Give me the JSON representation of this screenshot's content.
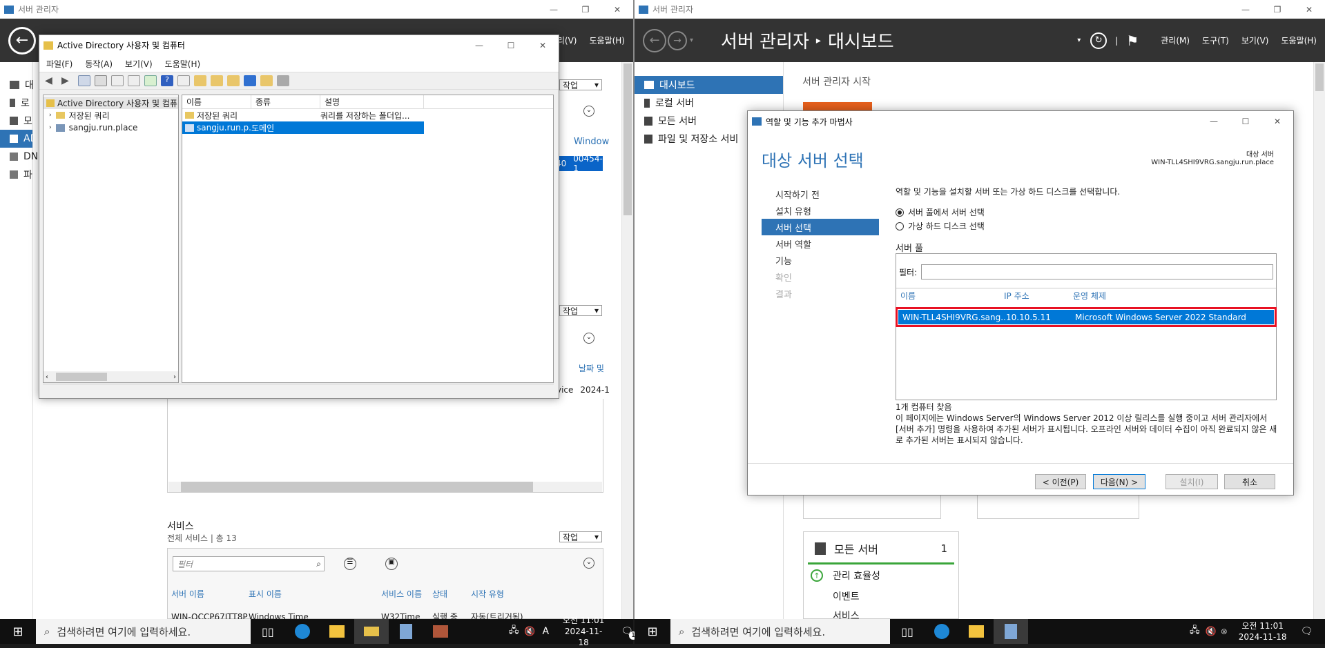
{
  "left_sm": {
    "title": "서버 관리자",
    "menus": [
      "리(V)",
      "도움말(H)"
    ],
    "nav": [
      "대",
      "로",
      "모",
      "AD",
      "DN",
      "파"
    ],
    "task_labels": [
      "작업",
      "작업",
      "작업"
    ],
    "fragments": {
      "windows": "Window",
      "row_a": "40",
      "row_b": "00454-1",
      "date_hdr": "날짜 및",
      "svc": "vice",
      "date_val": "2024-1"
    },
    "services": {
      "title": "서비스",
      "subtitle": "전체 서비스 | 총 13",
      "filter_placeholder": "필터",
      "columns": [
        "서버 이름",
        "표시 이름",
        "서비스 이름",
        "상태",
        "시작 유형"
      ],
      "row": [
        "WIN-OCCP67ITT8P",
        "Windows Time",
        "W32Time",
        "실행 중",
        "자동(트리거됨)"
      ]
    }
  },
  "ad": {
    "title": "Active Directory 사용자 및 컴퓨터",
    "menus": [
      "파일(F)",
      "동작(A)",
      "보기(V)",
      "도움말(H)"
    ],
    "tree_root": "Active Directory 사용자 및 컴퓨",
    "tree": [
      "저장된 쿼리",
      "sangju.run.place"
    ],
    "columns": [
      "이름",
      "종류",
      "설명"
    ],
    "rows": [
      {
        "name": "저장된 쿼리",
        "type": "",
        "desc": "쿼리를 저장하는 폴더입..."
      },
      {
        "name": "sangju.run.p...",
        "type": "도메인",
        "desc": ""
      }
    ]
  },
  "right_sm": {
    "title": "서버 관리자",
    "breadcrumb_a": "서버 관리자",
    "breadcrumb_b": "대시보드",
    "menus": [
      "관리(M)",
      "도구(T)",
      "보기(V)",
      "도움말(H)"
    ],
    "nav": [
      "대시보드",
      "로컬 서버",
      "모든 서버",
      "파일 및 저장소 서비"
    ],
    "welcome": "서버 관리자 시작",
    "tile": {
      "title": "모든 서버",
      "count": "1",
      "items": [
        "관리 효율성",
        "이벤트",
        "서비스"
      ]
    }
  },
  "wizard": {
    "title": "역할 및 기능 추가 마법사",
    "heading": "대상 서버 선택",
    "dest_label": "대상 서버",
    "dest_value": "WIN-TLL4SHI9VRG.sangju.run.place",
    "steps": [
      "시작하기 전",
      "설치 유형",
      "서버 선택",
      "서버 역할",
      "기능",
      "확인",
      "결과"
    ],
    "instruction": "역할 및 기능을 설치할 서버 또는 가상 하드 디스크를 선택합니다.",
    "radio1": "서버 풀에서 서버 선택",
    "radio2": "가상 하드 디스크 선택",
    "pool_label": "서버 풀",
    "filter_label": "필터:",
    "columns": [
      "이름",
      "IP 주소",
      "운영 체제"
    ],
    "row": {
      "name": "WIN-TLL4SHI9VRG.sang...",
      "ip": "10.10.5.11",
      "os": "Microsoft Windows Server 2022 Standard"
    },
    "found": "1개 컴퓨터 찾음",
    "note": "이 페이지에는 Windows Server의 Windows Server 2012 이상 릴리스를 실행 중이고 서버 관리자에서 [서버 추가] 명령을 사용하여 추가된 서버가 표시됩니다. 오프라인 서버와 데이터 수집이 아직 완료되지 않은 새로 추가된 서버는 표시되지 않습니다.",
    "buttons": {
      "prev": "< 이전(P)",
      "next": "다음(N) >",
      "install": "설치(I)",
      "cancel": "취소"
    }
  },
  "taskbar": {
    "search": "검색하려면 여기에 입력하세요.",
    "time": "오전 11:01",
    "date": "2024-11-18",
    "ime": "A",
    "notif": "1"
  },
  "colors": {
    "accent": "#2e73b5",
    "header": "#333333",
    "highlight": "#e81123",
    "green": "#3aa53a",
    "orange": "#e8601c"
  }
}
